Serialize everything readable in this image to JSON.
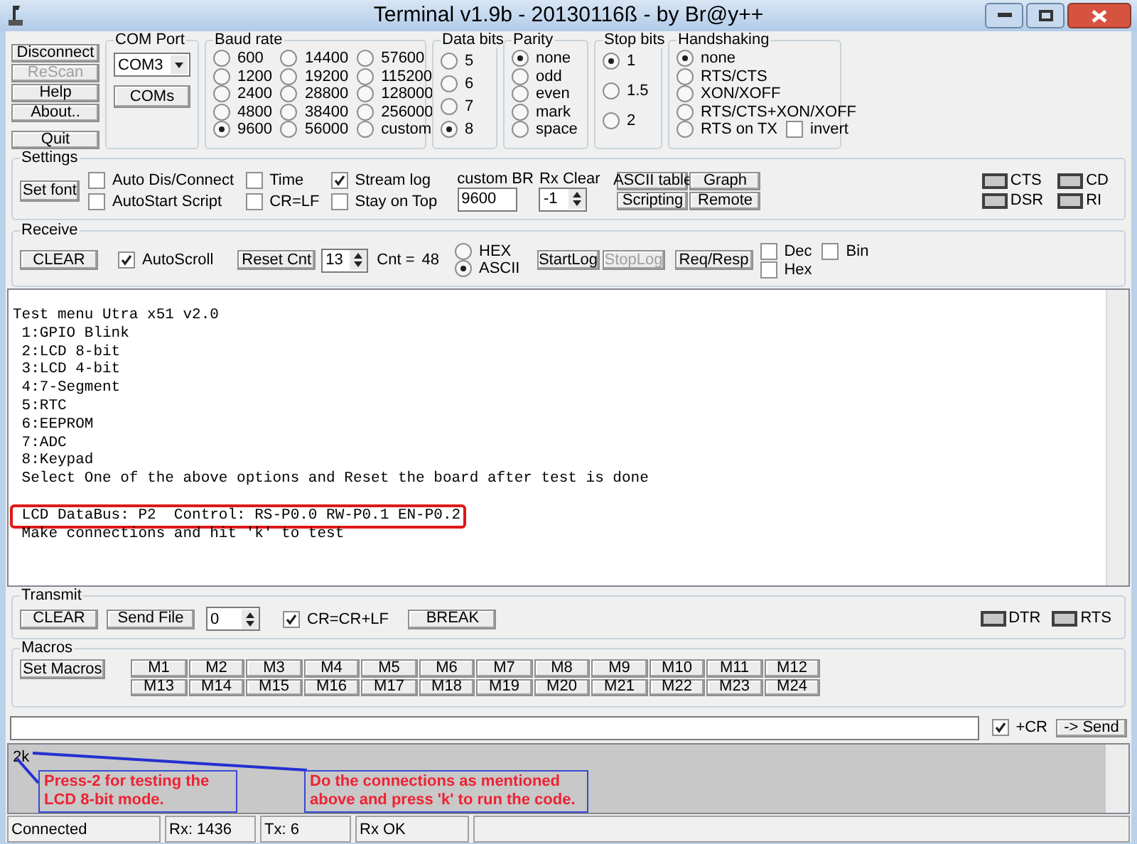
{
  "window": {
    "title": "Terminal v1.9b - 20130116ß - by Br@y++"
  },
  "connection_buttons": [
    {
      "label": "Disconnect",
      "disabled": false
    },
    {
      "label": "ReScan",
      "disabled": true
    },
    {
      "label": "Help",
      "disabled": false
    },
    {
      "label": "About..",
      "disabled": false
    },
    {
      "label": "Quit",
      "disabled": false
    }
  ],
  "com_port": {
    "title": "COM Port",
    "value": "COM3",
    "button": "COMs"
  },
  "baud_rate": {
    "title": "Baud rate",
    "options": [
      {
        "label": "600",
        "selected": false
      },
      {
        "label": "1200",
        "selected": false
      },
      {
        "label": "2400",
        "selected": false
      },
      {
        "label": "4800",
        "selected": false
      },
      {
        "label": "9600",
        "selected": true
      },
      {
        "label": "14400",
        "selected": false
      },
      {
        "label": "19200",
        "selected": false
      },
      {
        "label": "28800",
        "selected": false
      },
      {
        "label": "38400",
        "selected": false
      },
      {
        "label": "56000",
        "selected": false
      },
      {
        "label": "57600",
        "selected": false
      },
      {
        "label": "115200",
        "selected": false
      },
      {
        "label": "128000",
        "selected": false
      },
      {
        "label": "256000",
        "selected": false
      },
      {
        "label": "custom",
        "selected": false
      }
    ]
  },
  "data_bits": {
    "title": "Data bits",
    "options": [
      {
        "label": "5",
        "selected": false
      },
      {
        "label": "6",
        "selected": false
      },
      {
        "label": "7",
        "selected": false
      },
      {
        "label": "8",
        "selected": true
      }
    ]
  },
  "parity": {
    "title": "Parity",
    "options": [
      {
        "label": "none",
        "selected": true
      },
      {
        "label": "odd",
        "selected": false
      },
      {
        "label": "even",
        "selected": false
      },
      {
        "label": "mark",
        "selected": false
      },
      {
        "label": "space",
        "selected": false
      }
    ]
  },
  "stop_bits": {
    "title": "Stop bits",
    "options": [
      {
        "label": "1",
        "selected": true
      },
      {
        "label": "1.5",
        "selected": false
      },
      {
        "label": "2",
        "selected": false
      }
    ]
  },
  "handshaking": {
    "title": "Handshaking",
    "options": [
      {
        "label": "none",
        "selected": true
      },
      {
        "label": "RTS/CTS",
        "selected": false
      },
      {
        "label": "XON/XOFF",
        "selected": false
      },
      {
        "label": "RTS/CTS+XON/XOFF",
        "selected": false
      },
      {
        "label": "RTS on TX",
        "selected": false
      }
    ],
    "invert": {
      "label": "invert",
      "checked": false
    }
  },
  "settings": {
    "title": "Settings",
    "set_font": "Set font",
    "checkboxes": [
      {
        "label": "Auto Dis/Connect",
        "checked": false
      },
      {
        "label": "AutoStart Script",
        "checked": false
      },
      {
        "label": "Time",
        "checked": false
      },
      {
        "label": "CR=LF",
        "checked": false
      },
      {
        "label": "Stream log",
        "checked": true
      },
      {
        "label": "Stay on Top",
        "checked": false
      }
    ],
    "custom_br": {
      "label": "custom BR",
      "value": "9600"
    },
    "rx_clear": {
      "label": "Rx Clear",
      "value": "-1"
    },
    "buttons": [
      "ASCII table",
      "Graph",
      "Scripting",
      "Remote"
    ],
    "indicators": [
      "CTS",
      "DSR",
      "CD",
      "RI"
    ]
  },
  "receive": {
    "title": "Receive",
    "clear": "CLEAR",
    "autoscroll": {
      "label": "AutoScroll",
      "checked": true
    },
    "reset": "Reset Cnt",
    "counter": "13",
    "cnt_label": "Cnt =",
    "cnt_value": "48",
    "modes": [
      {
        "label": "HEX",
        "selected": false
      },
      {
        "label": "ASCII",
        "selected": true
      }
    ],
    "log_buttons": [
      {
        "label": "StartLog",
        "disabled": false
      },
      {
        "label": "StopLog",
        "disabled": true
      }
    ],
    "req_resp": "Req/Resp",
    "formats": [
      {
        "label": "Dec",
        "checked": false
      },
      {
        "label": "Hex",
        "checked": false
      },
      {
        "label": "Bin",
        "checked": false
      }
    ]
  },
  "terminal": {
    "paragraphs": [
      {
        "lines": [
          {
            "text": "Test menu Utra x51 v2.0",
            "highlighted": false
          },
          {
            "text": " 1:GPIO Blink",
            "highlighted": false
          },
          {
            "text": " 2:LCD 8-bit",
            "highlighted": false
          },
          {
            "text": " 3:LCD 4-bit",
            "highlighted": false
          },
          {
            "text": " 4:7-Segment",
            "highlighted": false
          },
          {
            "text": " 5:RTC",
            "highlighted": false
          },
          {
            "text": " 6:EEPROM",
            "highlighted": false
          },
          {
            "text": " 7:ADC",
            "highlighted": false
          },
          {
            "text": " 8:Keypad",
            "highlighted": false
          },
          {
            "text": " Select One of the above options and Reset the board after test is done",
            "highlighted": false
          }
        ]
      },
      {
        "lines": [
          {
            "text": " LCD DataBus: P2  Control: RS-P0.0 RW-P0.1 EN-P0.2",
            "highlighted": true
          },
          {
            "text": " Make connections and hit 'k' to test",
            "highlighted": false
          }
        ]
      }
    ]
  },
  "transmit": {
    "title": "Transmit",
    "clear": "CLEAR",
    "send_file": "Send File",
    "counter": "0",
    "cr": {
      "label": "CR=CR+LF",
      "checked": true
    },
    "break": "BREAK",
    "indicators": [
      "DTR",
      "RTS"
    ]
  },
  "macros": {
    "title": "Macros",
    "set": "Set Macros",
    "buttons": [
      "M1",
      "M2",
      "M3",
      "M4",
      "M5",
      "M6",
      "M7",
      "M8",
      "M9",
      "M10",
      "M11",
      "M12",
      "M13",
      "M14",
      "M15",
      "M16",
      "M17",
      "M18",
      "M19",
      "M20",
      "M21",
      "M22",
      "M23",
      "M24"
    ]
  },
  "send_row": {
    "plus_cr": {
      "label": "+CR",
      "checked": true
    },
    "send": "-> Send"
  },
  "transmit_log": {
    "text": "2k",
    "annotations": [
      "Press-2 for testing the LCD 8-bit mode.",
      "Do the connections as mentioned above and press 'k' to run the code."
    ]
  },
  "status_bar": [
    "Connected",
    "Rx: 1436",
    "Tx: 6",
    "Rx OK"
  ]
}
